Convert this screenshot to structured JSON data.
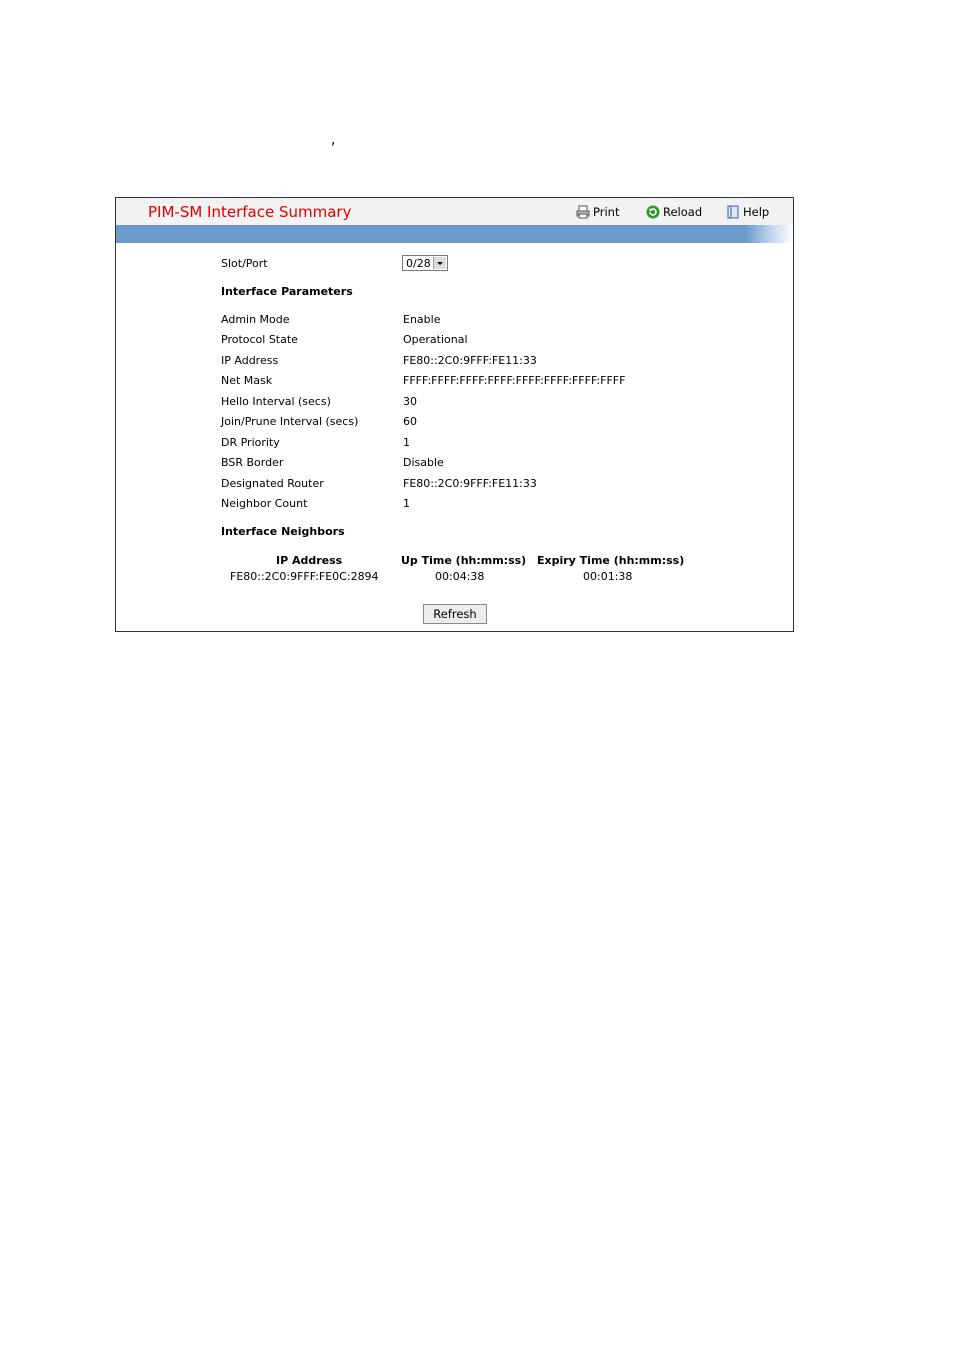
{
  "stray_mark": ",",
  "header": {
    "title": "PIM-SM Interface Summary",
    "print_label": "Print",
    "reload_label": "Reload",
    "help_label": "Help"
  },
  "slot_port": {
    "label": "Slot/Port",
    "value": "0/28"
  },
  "interface_parameters": {
    "heading": "Interface Parameters",
    "rows": [
      {
        "label": "Admin Mode",
        "value": "Enable"
      },
      {
        "label": "Protocol State",
        "value": "Operational"
      },
      {
        "label": "IP Address",
        "value": "FE80::2C0:9FFF:FE11:33"
      },
      {
        "label": "Net Mask",
        "value": "FFFF:FFFF:FFFF:FFFF:FFFF:FFFF:FFFF:FFFF"
      },
      {
        "label": "Hello Interval (secs)",
        "value": "30"
      },
      {
        "label": "Join/Prune Interval (secs)",
        "value": "60"
      },
      {
        "label": "DR Priority",
        "value": "1"
      },
      {
        "label": "BSR Border",
        "value": "Disable"
      },
      {
        "label": "Designated Router",
        "value": "FE80::2C0:9FFF:FE11:33"
      },
      {
        "label": "Neighbor Count",
        "value": "1"
      }
    ]
  },
  "interface_neighbors": {
    "heading": "Interface Neighbors",
    "columns": [
      "IP Address",
      "Up Time (hh:mm:ss)",
      "Expiry Time (hh:mm:ss)"
    ],
    "rows": [
      [
        "FE80::2C0:9FFF:FE0C:2894",
        "00:04:38",
        "00:01:38"
      ]
    ]
  },
  "refresh_label": "Refresh",
  "colors": {
    "title": "#e00000",
    "band": "#6b9acd"
  }
}
